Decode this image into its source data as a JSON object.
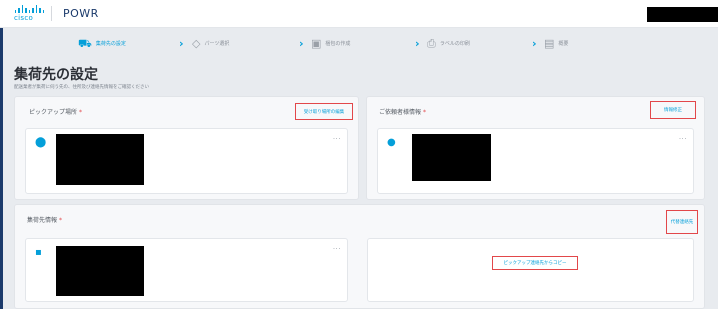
{
  "header": {
    "cisco_logo": "cisco",
    "app_name": "POWR"
  },
  "stepper": {
    "steps": [
      {
        "label": "集荷先の設定",
        "icon": "truck-icon",
        "active": true
      },
      {
        "label": "パーツ選択",
        "icon": "box-icon",
        "active": false
      },
      {
        "label": "梱包の作成",
        "icon": "package-icon",
        "active": false
      },
      {
        "label": "ラベルの印刷",
        "icon": "print-icon",
        "active": false
      },
      {
        "label": "概要",
        "icon": "document-icon",
        "active": false
      }
    ]
  },
  "page": {
    "title": "集荷先の設定",
    "subtitle": "配送業者が集荷に伺う先の、住所及び連絡先情報をご確認ください"
  },
  "pickup": {
    "label": "ピックアップ場所",
    "required_mark": "*",
    "edit_link": "受け取り場所の編集",
    "menu": "···"
  },
  "requester": {
    "label": "ご依頼者様情報",
    "required_mark": "*",
    "edit_link": "情報修正",
    "menu": "···"
  },
  "collection": {
    "label": "集荷先情報",
    "required_mark": "*",
    "proxy_link": "代替連絡先",
    "menu": "···",
    "copy_link": "ピックアップ連絡先からコピー"
  }
}
